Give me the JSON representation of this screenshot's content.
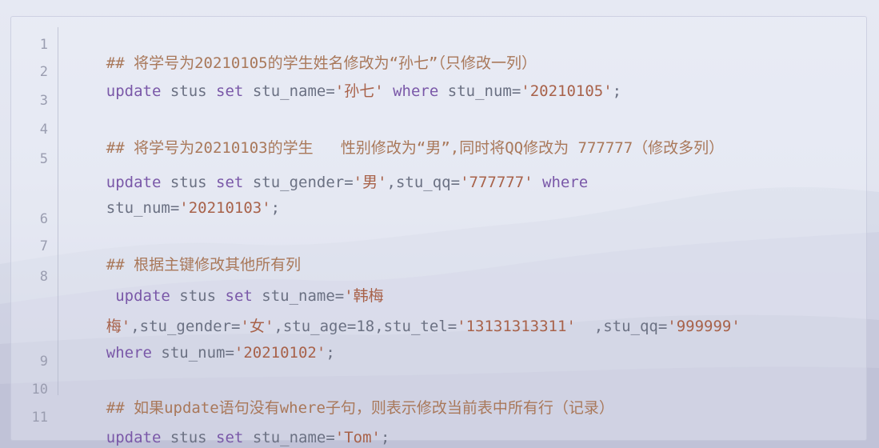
{
  "line_numbers": [
    "1",
    "2",
    "3",
    "4",
    "5",
    "6",
    "7",
    "8",
    "9",
    "10",
    "11"
  ],
  "lines": {
    "l1": {
      "comment": "## 将学号为20210105的学生姓名修改为“孙七”（只修改一列）"
    },
    "l2": {
      "kw_update": "update",
      "t_table": " stus ",
      "kw_set": "set",
      "t_col": " stu_name=",
      "s_val": "'孙七'",
      "sp1": " ",
      "kw_where": "where",
      "t_cond": " stu_num=",
      "s_cond": "'20210105'",
      "t_end": ";"
    },
    "l4": {
      "comment": "## 将学号为20210103的学生   性别修改为“男”,同时将QQ修改为 777777（修改多列）"
    },
    "l5a": {
      "kw_update": "update",
      "t_table": " stus ",
      "kw_set": "set",
      "t_col": " stu_gender=",
      "s_val": "'男'",
      "t_col2": ",stu_qq=",
      "s_val2": "'777777'",
      "sp1": " ",
      "kw_where": "where"
    },
    "l5b": {
      "t_cond": "stu_num=",
      "s_cond": "'20210103'",
      "t_end": ";"
    },
    "l7": {
      "comment": "## 根据主键修改其他所有列"
    },
    "l8a": {
      "lead": " ",
      "kw_update": "update",
      "t_table": " stus ",
      "kw_set": "set",
      "t_col": " stu_name=",
      "s_val": "'韩梅"
    },
    "l8b": {
      "s_val": "梅'",
      "t_col": ",stu_gender=",
      "s_val2": "'女'",
      "t_col2": ",stu_age=18,stu_tel=",
      "s_val3": "'13131313311'",
      "t_col3": "  ,stu_qq=",
      "s_val4": "'999999'"
    },
    "l8c": {
      "kw_where": "where",
      "t_cond": " stu_num=",
      "s_cond": "'20210102'",
      "t_end": ";"
    },
    "l10": {
      "comment": "## 如果update语句没有where子句，则表示修改当前表中所有行（记录）"
    },
    "l11": {
      "kw_update": "update",
      "t_table": " stus ",
      "kw_set": "set",
      "t_col": " stu_name=",
      "s_val": "'Tom'",
      "t_end": ";"
    }
  },
  "colors": {
    "keyword": "#7a58a8",
    "identifier": "#6b7183",
    "string": "#a8624a",
    "comment": "#a9785a",
    "line_number": "#9a9db0"
  }
}
